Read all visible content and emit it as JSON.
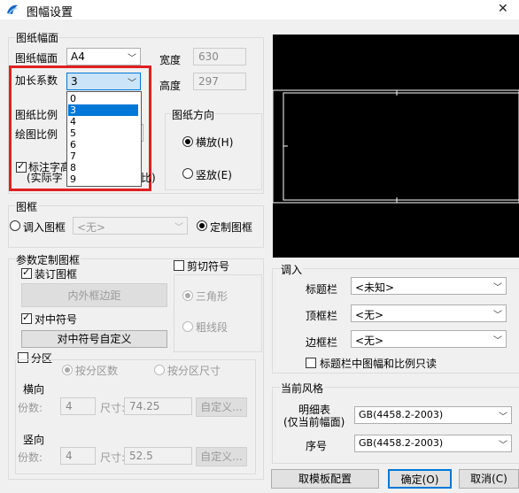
{
  "window": {
    "title": "图幅设置",
    "close": "✕"
  },
  "sheet": {
    "group": "图纸幅面",
    "size_label": "图纸幅面",
    "size_value": "A4",
    "width_label": "宽度",
    "width_value": "630",
    "height_label": "高度",
    "height_value": "297",
    "factor_label": "加长系数",
    "factor_value": "3",
    "factor_options": [
      "0",
      "3",
      "4",
      "5",
      "6",
      "7",
      "8",
      "9"
    ],
    "factor_selected_index": 1
  },
  "scale": {
    "paper_label": "图纸比例",
    "draw_label": "绘图比例",
    "annotate_label": "标注字高",
    "actual_label": "(实际字",
    "actual_suffix": "比)"
  },
  "orientation": {
    "group": "图纸方向",
    "landscape": "横放(H)",
    "portrait": "竖放(E)"
  },
  "frame": {
    "group": "图框",
    "import_label": "调入图框",
    "import_value": "<无>",
    "custom_label": "定制图框"
  },
  "params": {
    "group": "参数定制图框",
    "binding_label": "装订图框",
    "inner_outer_btn": "内外框边距",
    "center_label": "对中符号",
    "center_custom_btn": "对中符号自定义",
    "cut_label": "剪切符号",
    "triangle": "三角形",
    "thick": "粗线段"
  },
  "zones": {
    "label": "分区",
    "by_count": "按分区数",
    "by_size": "按分区尺寸",
    "horizontal": "横向",
    "vertical": "竖向",
    "count_label": "份数:",
    "size_label": "尺寸:",
    "h_count": "4",
    "h_size": "74.25",
    "v_count": "4",
    "v_size": "52.5",
    "custom_btn": "自定义..."
  },
  "load": {
    "group": "调入",
    "title_label": "标题栏",
    "title_value": "<未知>",
    "top_label": "顶框栏",
    "top_value": "<无>",
    "side_label": "边框栏",
    "side_value": "<无>",
    "readonly_label": "标题栏中图幅和比例只读"
  },
  "style": {
    "group": "当前风格",
    "detail_label": "明细表",
    "detail_label2": "(仅当前幅面)",
    "detail_value": "GB(4458.2-2003)",
    "seq_label": "序号",
    "seq_value": "GB(4458.2-2003)"
  },
  "buttons": {
    "template": "取模板配置",
    "ok": "确定(O)",
    "cancel": "取消(C)"
  },
  "colors": {
    "accent": "#0078d7",
    "highlight": "#e02020",
    "preview": "#000000"
  }
}
